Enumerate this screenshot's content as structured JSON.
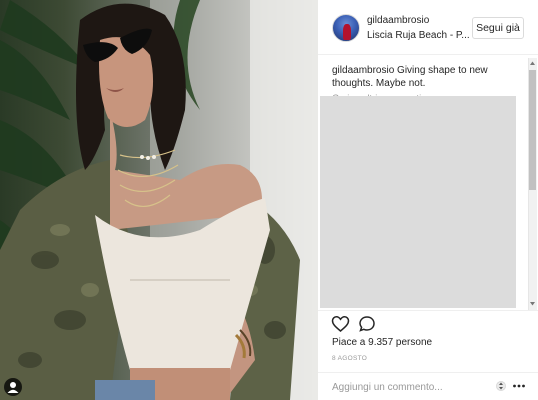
{
  "post": {
    "username": "gildaambrosio",
    "location": "Liscia Ruja Beach - P...",
    "follow_label": "Segui già",
    "caption_user": "gildaambrosio",
    "caption_text": "Giving shape to new thoughts. Maybe not.",
    "load_more_comments": "Carica altri commenti",
    "likes_text": "Piace a 9.357 persone",
    "date_text": "8 AGOSTO",
    "comment_placeholder": "Aggiungi un commento..."
  },
  "icons": {
    "like": "heart-outline-icon",
    "comment": "speech-bubble-icon",
    "options": "three-dots-icon",
    "user_tag": "person-icon",
    "stepper": "up-down-arrows-icon"
  },
  "colors": {
    "text": "#262626",
    "muted": "#999999",
    "border": "#dbdbdb",
    "placeholder_block": "#dcdcdc"
  }
}
